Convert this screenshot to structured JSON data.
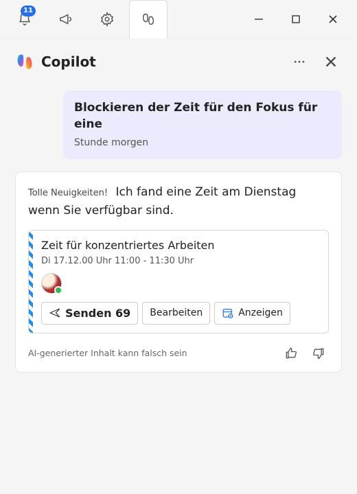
{
  "titlebar": {
    "notifications_badge": "11"
  },
  "pane": {
    "title": "Copilot"
  },
  "user_message": {
    "line1": "Blockieren der Zeit für den Fokus für eine",
    "line2": "Stunde morgen"
  },
  "assistant": {
    "lead": "Tolle Neuigkeiten!",
    "body": "Ich fand eine Zeit am Dienstag wenn Sie verfügbar sind."
  },
  "event": {
    "title": "Zeit für konzentriertes Arbeiten",
    "time": "Di 17.12.00 Uhr 11:00 - 11:30 Uhr",
    "actions": {
      "send": "Senden 69",
      "edit": "Bearbeiten",
      "view": "Anzeigen"
    }
  },
  "footer": {
    "disclaimer": "AI-generierter Inhalt kann falsch sein"
  }
}
